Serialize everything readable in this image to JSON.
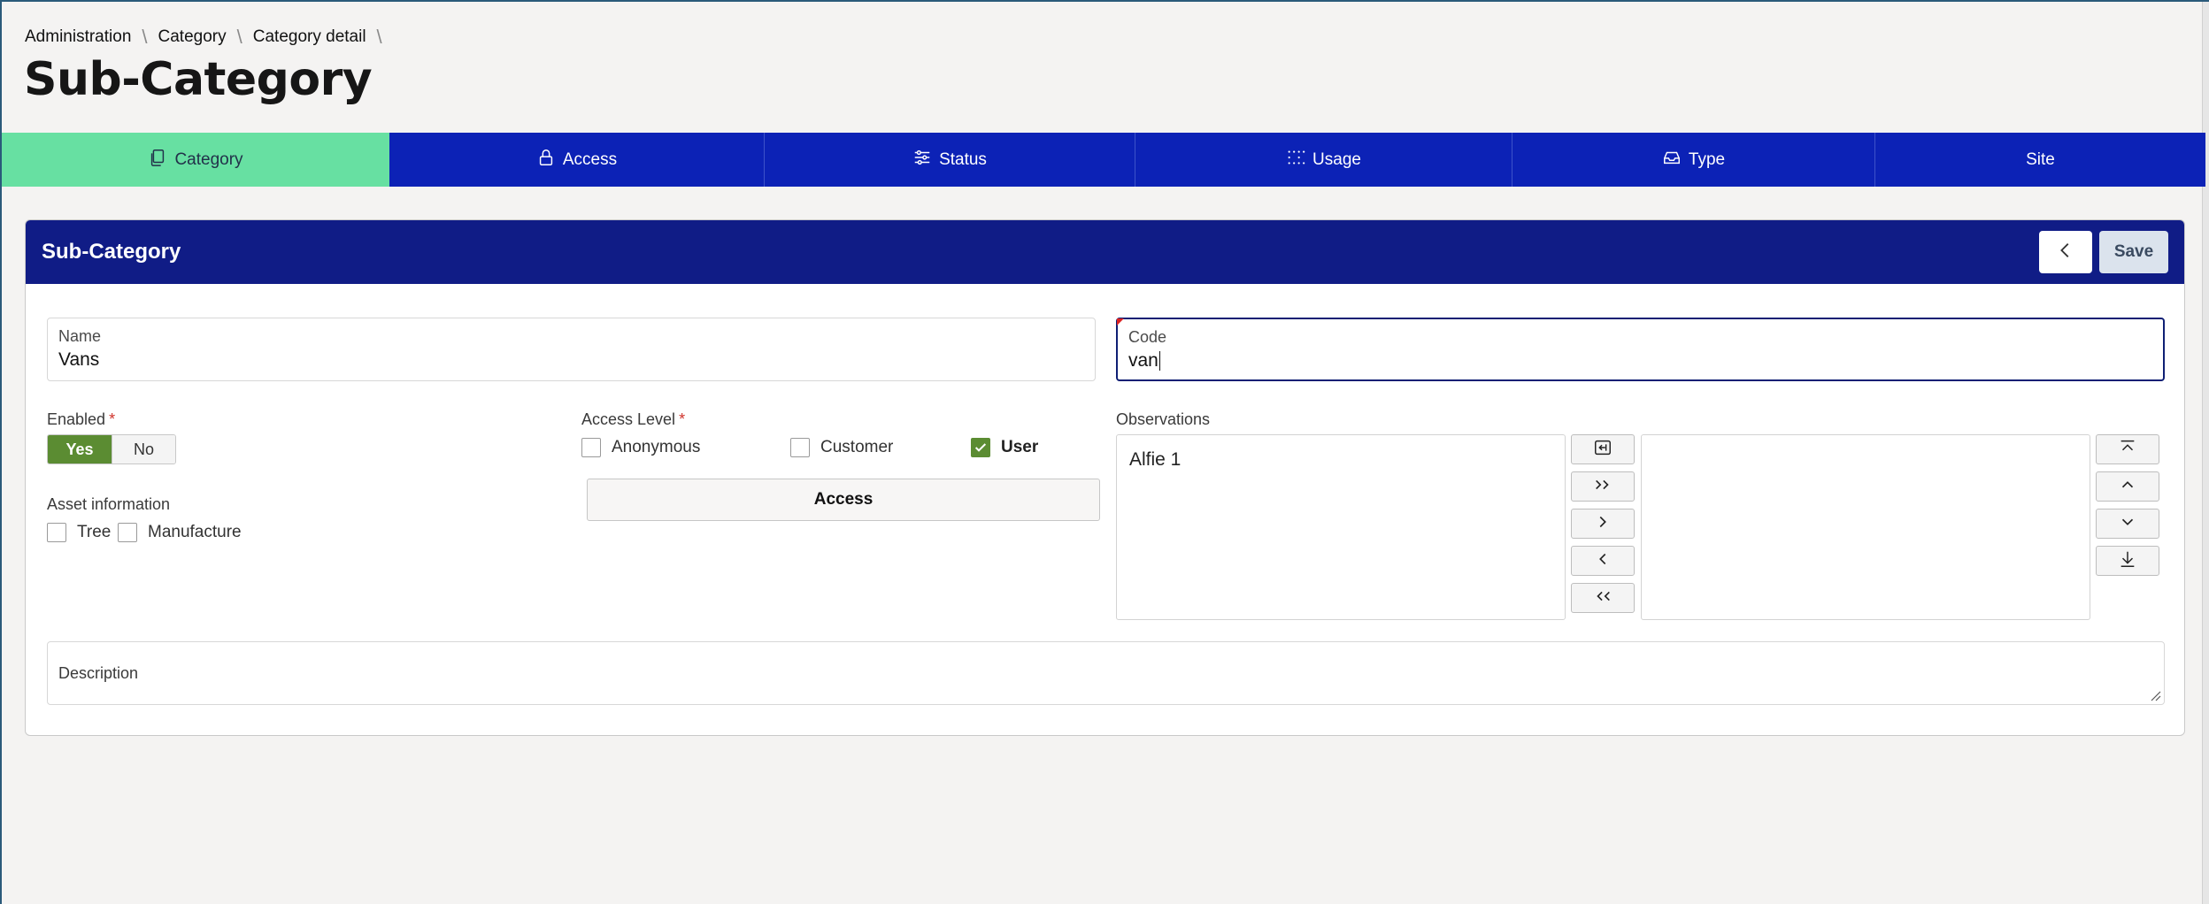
{
  "breadcrumb": {
    "items": [
      "Administration",
      "Category",
      "Category detail"
    ],
    "separator": "\\"
  },
  "page_title": "Sub-Category",
  "tabs": [
    {
      "label": "Category",
      "icon": "copy-icon",
      "active": true
    },
    {
      "label": "Access",
      "icon": "lock-icon",
      "active": false
    },
    {
      "label": "Status",
      "icon": "sliders-icon",
      "active": false
    },
    {
      "label": "Usage",
      "icon": "dots-grid-icon",
      "active": false
    },
    {
      "label": "Type",
      "icon": "inbox-icon",
      "active": false
    },
    {
      "label": "Site",
      "icon": "",
      "active": false
    }
  ],
  "panel": {
    "title": "Sub-Category",
    "save_label": "Save"
  },
  "form": {
    "name": {
      "label": "Name",
      "value": "Vans"
    },
    "code": {
      "label": "Code",
      "value": "van"
    },
    "enabled": {
      "label": "Enabled",
      "required_mark": "*",
      "yes": "Yes",
      "no": "No",
      "selected": "Yes"
    },
    "asset_information": {
      "label": "Asset information",
      "options": [
        {
          "label": "Tree",
          "checked": false
        },
        {
          "label": "Manufacture",
          "checked": false
        }
      ]
    },
    "access_level": {
      "label": "Access Level",
      "required_mark": "*",
      "options": [
        {
          "label": "Anonymous",
          "checked": false
        },
        {
          "label": "Customer",
          "checked": false
        },
        {
          "label": "User",
          "checked": true
        }
      ],
      "button_label": "Access"
    },
    "observations": {
      "label": "Observations",
      "available": [
        "Alfie 1"
      ],
      "selected": []
    },
    "description": {
      "label": "Description",
      "value": ""
    }
  },
  "colors": {
    "tab_bar": "#0c22b6",
    "tab_active": "#67e0a2",
    "panel_header": "#101c86",
    "toggle_on": "#5b8c32",
    "required": "#d0342c"
  }
}
